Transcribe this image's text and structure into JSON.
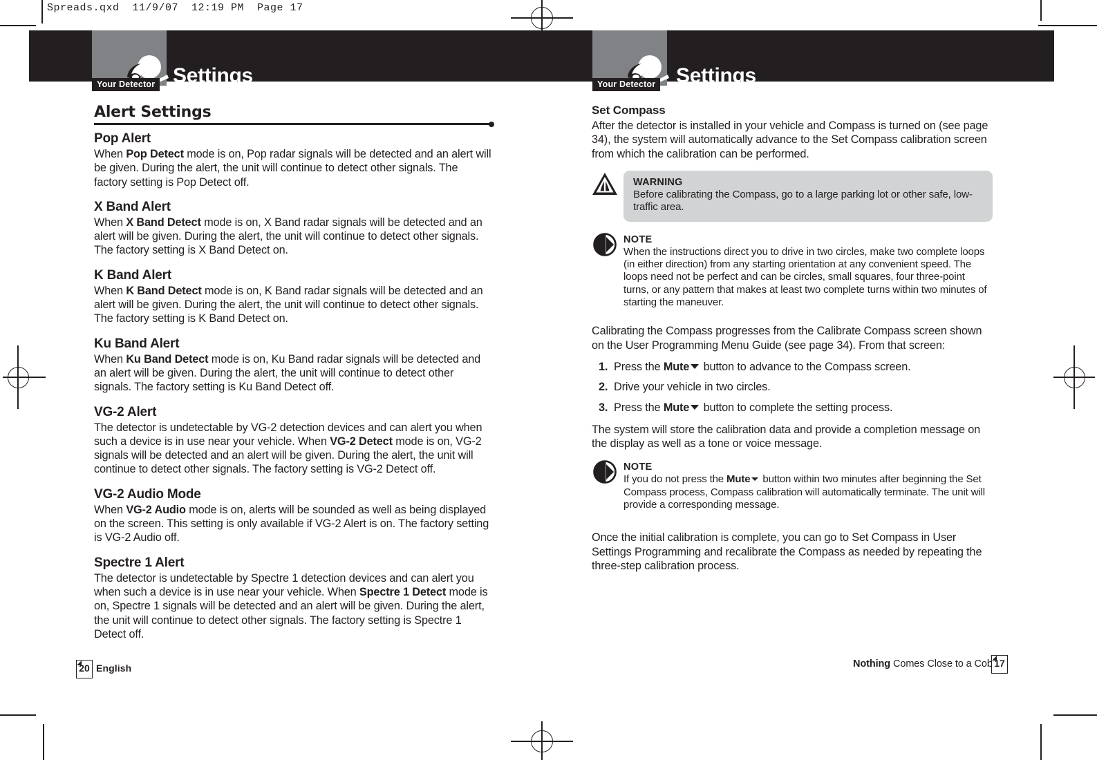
{
  "slug": "Spreads.qxd  11/9/07  12:19 PM  Page 17",
  "colors": {
    "header_band": "#231f20",
    "header_tab": "#808285",
    "warning_box": "#d1d3d4",
    "text": "#231f20",
    "paper": "#ffffff"
  },
  "left_page": {
    "header": {
      "tab_label": "Your Detector",
      "title": "Settings",
      "logo_icon": "cobra-detector-icon"
    },
    "section_title": "Alert Settings",
    "blocks": [
      {
        "heading": "Pop Alert",
        "paragraph": [
          {
            "t": "When "
          },
          {
            "t": "Pop Detect",
            "b": true
          },
          {
            "t": " mode is on, Pop radar signals will be detected and an alert will be given. During the alert, the unit will continue to detect other signals. The factory setting is Pop Detect off."
          }
        ]
      },
      {
        "heading": "X Band Alert",
        "paragraph": [
          {
            "t": "When "
          },
          {
            "t": "X Band Detect",
            "b": true
          },
          {
            "t": " mode is on, X Band radar signals will be detected and an alert will be given. During the alert, the unit will continue to detect other signals. The factory setting is X Band Detect on."
          }
        ]
      },
      {
        "heading": "K Band Alert",
        "paragraph": [
          {
            "t": "When "
          },
          {
            "t": "K Band Detect",
            "b": true
          },
          {
            "t": " mode is on, K Band radar signals will be detected and an alert will be given. During the alert, the unit will continue to detect other signals. The factory setting is K Band Detect on."
          }
        ]
      },
      {
        "heading": "Ku Band Alert",
        "paragraph": [
          {
            "t": "When "
          },
          {
            "t": "Ku Band Detect",
            "b": true
          },
          {
            "t": " mode is on, Ku Band radar signals will be detected and an alert will be given. During the alert, the unit will continue to detect other signals. The factory setting is Ku Band Detect off."
          }
        ]
      },
      {
        "heading": "VG-2 Alert",
        "paragraph": [
          {
            "t": "The detector is undetectable by VG-2 detection devices and can alert you when such a device is in use near your vehicle. When "
          },
          {
            "t": "VG-2 Detect",
            "b": true
          },
          {
            "t": " mode is on, VG-2 signals will be detected and an alert will be given. During the alert, the unit will continue to detect other signals. The factory setting is VG-2 Detect off."
          }
        ]
      },
      {
        "heading": "VG-2 Audio Mode",
        "paragraph": [
          {
            "t": "When "
          },
          {
            "t": "VG-2 Audio",
            "b": true
          },
          {
            "t": " mode is on, alerts will be sounded as well as being displayed on the screen. This setting is only available if VG-2 Alert is on. The factory setting is VG-2 Audio off."
          }
        ]
      },
      {
        "heading": "Spectre 1 Alert",
        "paragraph": [
          {
            "t": "The detector is undetectable by Spectre 1 detection devices and can alert you when such a device is in use near your vehicle. When "
          },
          {
            "t": "Spectre 1 Detect",
            "b": true
          },
          {
            "t": " mode is on, Spectre 1 signals will be detected and an alert will be given. During the alert, the unit will continue to detect other signals. The factory setting is Spectre 1 Detect off."
          }
        ]
      }
    ],
    "footer": {
      "page_number": "20",
      "label": "English"
    }
  },
  "right_page": {
    "header": {
      "tab_label": "Your Detector",
      "title": "Settings",
      "logo_icon": "cobra-detector-icon"
    },
    "heading": "Set Compass",
    "intro": "After the detector is installed in your vehicle and Compass is turned on (see page 34), the system will automatically advance to the Set Compass calibration screen from which the calibration can be performed.",
    "warning": {
      "icon": "warning-triangle-icon",
      "title": "WARNING",
      "text": "Before calibrating the Compass, go to a large parking lot or other safe, low-traffic area."
    },
    "note1": {
      "icon": "note-circle-icon",
      "title": "NOTE",
      "text": "When the instructions direct you to drive in two circles, make two complete loops (in either direction) from any starting orientation at any convenient speed. The loops need not be perfect and can be circles, small squares, four three-point turns, or any pattern that makes at least two complete turns within two minutes of starting the maneuver."
    },
    "calibrating_intro": "Calibrating the Compass progresses from the Calibrate Compass screen shown on the User Programming Menu Guide (see page 34). From that screen:",
    "steps": [
      {
        "num": "1.",
        "parts": [
          {
            "t": "Press the "
          },
          {
            "t": "Mute",
            "b": true
          },
          {
            "caret": true
          },
          {
            "t": " button to advance to the Compass screen."
          }
        ]
      },
      {
        "num": "2.",
        "parts": [
          {
            "t": "Drive your vehicle in two circles."
          }
        ]
      },
      {
        "num": "3.",
        "parts": [
          {
            "t": "Press the "
          },
          {
            "t": "Mute",
            "b": true
          },
          {
            "caret": true
          },
          {
            "t": " button to complete the setting process."
          }
        ]
      }
    ],
    "after_steps": "The system will store the calibration data and provide a completion message on the display as well as a tone or voice message.",
    "note2": {
      "icon": "note-circle-icon",
      "title": "NOTE",
      "parts": [
        {
          "t": "If you do not press the "
        },
        {
          "t": "Mute",
          "b": true
        },
        {
          "caret": true
        },
        {
          "t": " button within two minutes after beginning the Set Compass process, Compass calibration will automatically terminate. The unit will provide a corresponding message."
        }
      ]
    },
    "closing": "Once the initial calibration is complete, you can go to Set Compass in User Settings Programming and recalibrate the Compass as needed by repeating the three-step calibration process.",
    "footer": {
      "page_number": "17",
      "tagline_bold": "Nothing",
      "tagline_rest": " Comes Close to a Cobra",
      "tagline_mark": "®"
    }
  }
}
